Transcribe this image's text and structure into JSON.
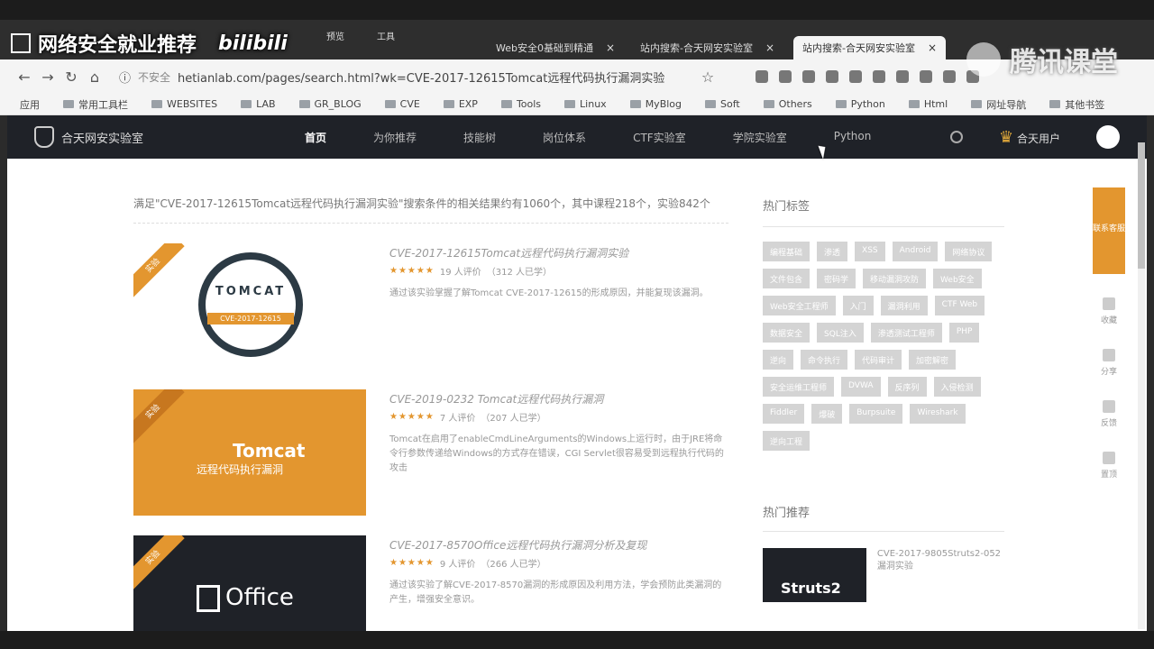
{
  "overlay": {
    "title": "网络安全就业推荐",
    "brand": "bilibili",
    "watermark": "腾讯课堂"
  },
  "menu": [
    "预览",
    "工具"
  ],
  "tabs": [
    {
      "label": "Web安全0基础到精通"
    },
    {
      "label": "站内搜索-合天网安实验室"
    },
    {
      "label": "站内搜索-合天网安实验室"
    }
  ],
  "address": {
    "insecure": "不安全",
    "url": "hetianlab.com/pages/search.html?wk=CVE-2017-12615Tomcat远程代码执行漏洞实验"
  },
  "bookmarks": [
    "应用",
    "常用工具栏",
    "WEBSITES",
    "LAB",
    "GR_BLOG",
    "CVE",
    "EXP",
    "Tools",
    "Linux",
    "MyBlog",
    "Soft",
    "Others",
    "Python",
    "Html",
    "网址导航",
    "其他书签"
  ],
  "site": {
    "name": "合天网安实验室",
    "nav": [
      "首页",
      "为你推荐",
      "技能树",
      "岗位体系",
      "CTF实验室",
      "学院实验室",
      "Python"
    ],
    "user": "合天用户"
  },
  "summary": "满足\"CVE-2017-12615Tomcat远程代码执行漏洞实验\"搜索条件的相关结果约有1060个，其中课程218个，实验842个",
  "results": [
    {
      "ribbon": "实验",
      "title": "CVE-2017-12615Tomcat远程代码执行漏洞实验",
      "stars": "★★★★★",
      "reviews": "19 人评价",
      "learners": "（312 人已学）",
      "desc": "通过该实验掌握了解Tomcat CVE-2017-12615的形成原因，并能复现该漏洞。",
      "thumb_word": "TOMCAT",
      "thumb_band": "CVE-2017-12615"
    },
    {
      "ribbon": "实验",
      "title": "CVE-2019-0232 Tomcat远程代码执行漏洞",
      "stars": "★★★★★",
      "reviews": "7 人评价",
      "learners": "（207 人已学）",
      "desc": "Tomcat在启用了enableCmdLineArguments的Windows上运行时，由于JRE将命令行参数传递给Windows的方式存在错误，CGI Servlet很容易受到远程执行代码的攻击",
      "thumb_word": "Tomcat",
      "thumb_sub": "远程代码执行漏洞"
    },
    {
      "ribbon": "实验",
      "title": "CVE-2017-8570Office远程代码执行漏洞分析及复现",
      "stars": "★★★★★",
      "reviews": "9 人评价",
      "learners": "（266 人已学）",
      "desc": "通过该实验了解CVE-2017-8570漏洞的形成原因及利用方法，学会预防此类漏洞的产生，增强安全意识。",
      "thumb_word": "Office"
    }
  ],
  "sidebar": {
    "tags_title": "热门标签",
    "tags": [
      "编程基础",
      "渗透",
      "XSS",
      "Android",
      "网络协议",
      "文件包含",
      "密码学",
      "移动漏洞攻防",
      "Web安全",
      "Web安全工程师",
      "入门",
      "漏洞利用",
      "CTF Web",
      "数据安全",
      "SQL注入",
      "渗透测试工程师",
      "PHP",
      "逆向",
      "命令执行",
      "代码审计",
      "加密解密",
      "安全运维工程师",
      "DVWA",
      "反序列",
      "入侵检测",
      "Fiddler",
      "爆破",
      "Burpsuite",
      "Wireshark",
      "逆向工程"
    ],
    "rec_title": "热门推荐",
    "rec_thumb": "Struts2",
    "rec_item": "CVE-2017-9805Struts2-052漏洞实验"
  },
  "float": {
    "main": "联系客服",
    "items": [
      "收藏",
      "分享",
      "反馈",
      "置顶"
    ]
  }
}
